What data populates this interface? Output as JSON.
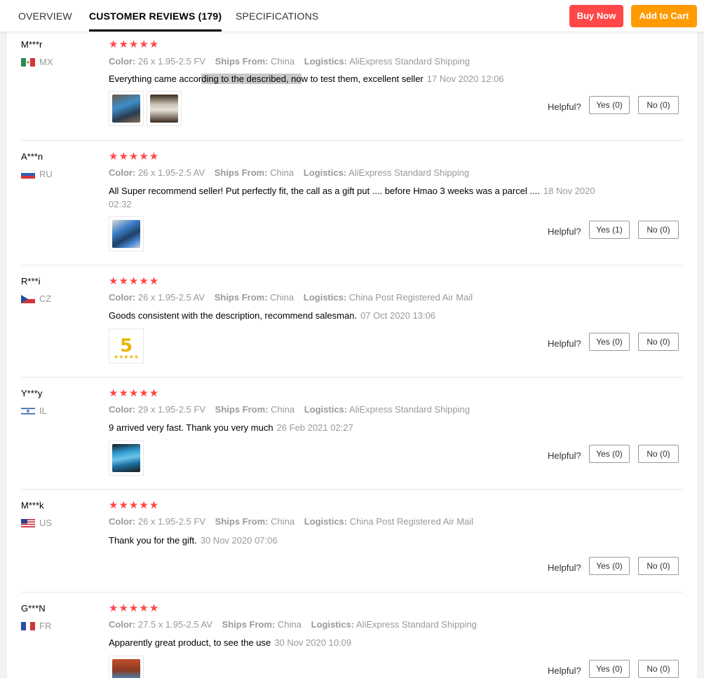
{
  "tabs": {
    "overview": "OVERVIEW",
    "reviews": "CUSTOMER REVIEWS (179)",
    "specs": "SPECIFICATIONS"
  },
  "actions": {
    "buy_now": "Buy Now",
    "add_to_cart": "Add to Cart"
  },
  "labels": {
    "color": "Color:",
    "ships_from": "Ships From:",
    "logistics": "Logistics:",
    "helpful": "Helpful?"
  },
  "colors": {
    "accent_red": "#ff4747",
    "accent_orange": "#ff9a00",
    "star": "#ff4747"
  },
  "reviews": [
    {
      "user": "M***r",
      "country": "MX",
      "stars": "★★★★★",
      "rating": 5,
      "color": "26 x 1.95-2.5 FV",
      "ships_from": "China",
      "logistics": "AliExpress Standard Shipping",
      "text_a": "Everything came accor",
      "text_hl": "ding to the described, no",
      "text_b": "w to test them, excellent seller",
      "date": "17 Nov 2020 12:06",
      "yes": "Yes (0)",
      "no": "No (0)"
    },
    {
      "user": "A***n",
      "country": "RU",
      "stars": "★★★★★",
      "rating": 5,
      "color": "26 x 1.95-2.5 AV",
      "ships_from": "China",
      "logistics": "AliExpress Standard Shipping",
      "text": "All Super recommend seller! Put perfectly fit, the call as a gift put .... before Hmao 3 weeks was a parcel ....",
      "date": "18 Nov 2020 02:32",
      "yes": "Yes (1)",
      "no": "No (0)"
    },
    {
      "user": "R***i",
      "country": "CZ",
      "stars": "★★★★★",
      "rating": 5,
      "color": "26 x 1.95-2.5 AV",
      "ships_from": "China",
      "logistics": "China Post Registered Air Mail",
      "text": "Goods consistent with the description, recommend salesman.",
      "date": "07 Oct 2020 13:06",
      "yes": "Yes (0)",
      "no": "No (0)"
    },
    {
      "user": "Y***y",
      "country": "IL",
      "stars": "★★★★★",
      "rating": 5,
      "color": "29 x 1.95-2.5 FV",
      "ships_from": "China",
      "logistics": "AliExpress Standard Shipping",
      "text": "9 arrived very fast. Thank you very much",
      "date": "26 Feb 2021 02:27",
      "yes": "Yes (0)",
      "no": "No (0)"
    },
    {
      "user": "M***k",
      "country": "US",
      "stars": "★★★★★",
      "rating": 5,
      "color": "26 x 1.95-2.5 FV",
      "ships_from": "China",
      "logistics": "China Post Registered Air Mail",
      "text": "Thank you for the gift.",
      "date": "30 Nov 2020 07:06",
      "yes": "Yes (0)",
      "no": "No (0)"
    },
    {
      "user": "G***N",
      "country": "FR",
      "stars": "★★★★★",
      "rating": 5,
      "color": "27.5 x 1.95-2.5 AV",
      "ships_from": "China",
      "logistics": "AliExpress Standard Shipping",
      "text": "Apparently great product, to see the use",
      "date": "30 Nov 2020 10:09",
      "yes": "Yes (0)",
      "no": "No (0)"
    }
  ]
}
